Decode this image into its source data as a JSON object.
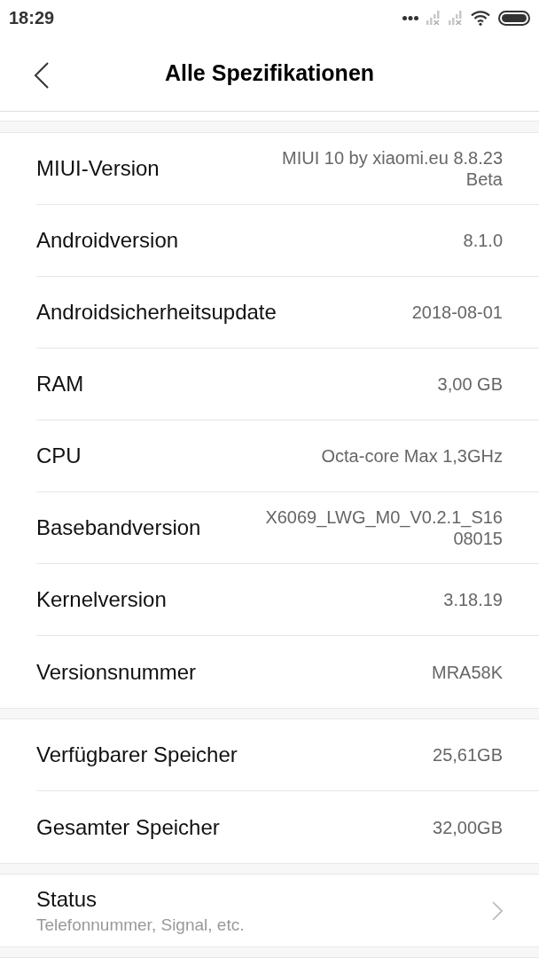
{
  "status_bar": {
    "time": "18:29"
  },
  "header": {
    "title": "Alle Spezifikationen"
  },
  "sections": [
    {
      "rows": [
        {
          "label": "MIUI-Version",
          "value": "MIUI 10 by xiaomi.eu 8.8.23 Beta"
        },
        {
          "label": "Androidversion",
          "value": "8.1.0"
        },
        {
          "label": "Androidsicherheitsupdate",
          "value": "2018-08-01"
        },
        {
          "label": "RAM",
          "value": "3,00 GB"
        },
        {
          "label": "CPU",
          "value": "Octa-core Max 1,3GHz"
        },
        {
          "label": "Basebandversion",
          "value": "X6069_LWG_M0_V0.2.1_S1608015"
        },
        {
          "label": "Kernelversion",
          "value": "3.18.19"
        },
        {
          "label": "Versionsnummer",
          "value": "MRA58K"
        }
      ]
    },
    {
      "rows": [
        {
          "label": "Verfügbarer Speicher",
          "value": "25,61GB"
        },
        {
          "label": "Gesamter Speicher",
          "value": "32,00GB"
        }
      ]
    }
  ],
  "status_item": {
    "title": "Status",
    "subtitle": "Telefonnummer, Signal, etc."
  }
}
